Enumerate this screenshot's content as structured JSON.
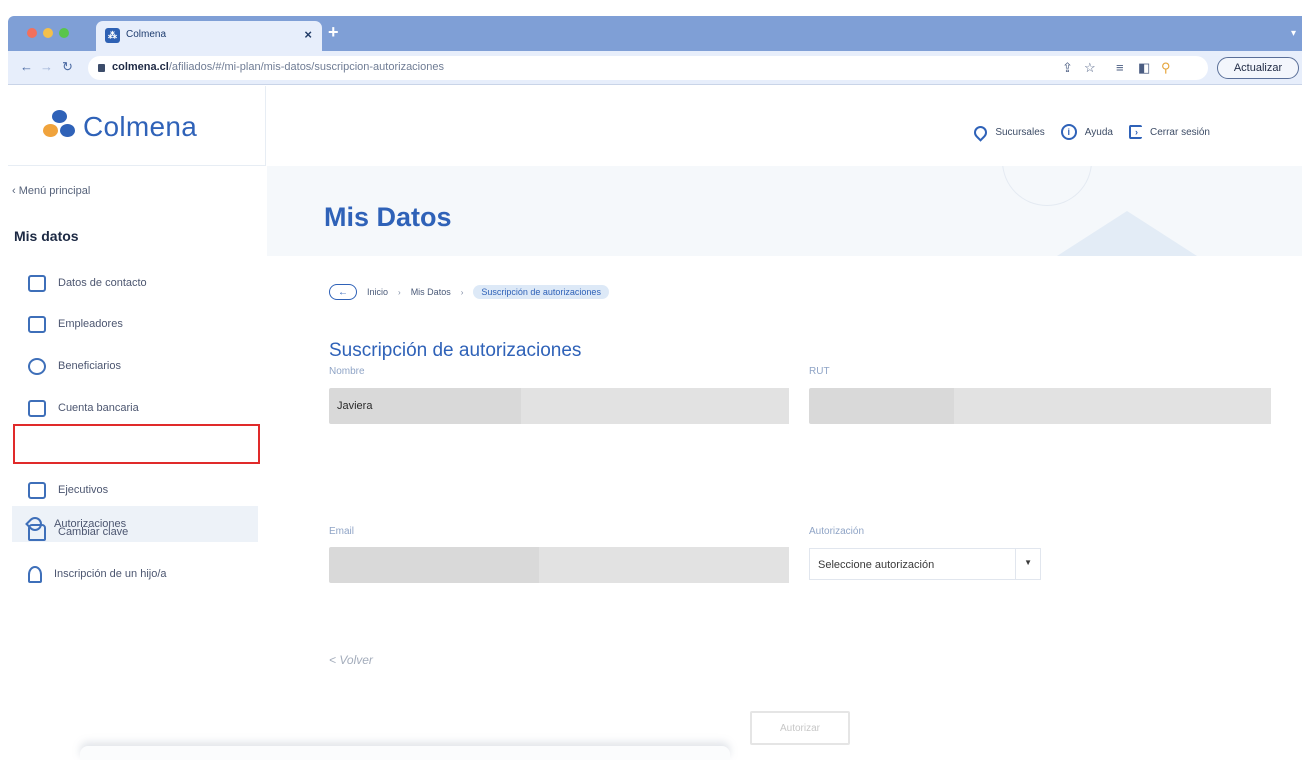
{
  "browser": {
    "tab_title": "Colmena",
    "url_domain": "colmena.cl",
    "url_path": "/afiliados/#/mi-plan/mis-datos/suscripcion-autorizaciones",
    "update_label": "Actualizar"
  },
  "header": {
    "logo_text": "Colmena",
    "links": [
      {
        "label": "Sucursales",
        "icon": "location-pin-icon"
      },
      {
        "label": "Ayuda",
        "icon": "info-icon"
      },
      {
        "label": "Cerrar sesión",
        "icon": "logout-icon"
      }
    ]
  },
  "sidebar": {
    "back_label": "‹ Menú principal",
    "section_title": "Mis datos",
    "items": [
      {
        "label": "Datos de contacto",
        "icon": "contact-card-icon"
      },
      {
        "label": "Empleadores",
        "icon": "building-icon"
      },
      {
        "label": "Beneficiarios",
        "icon": "people-icon"
      },
      {
        "label": "Cuenta bancaria",
        "icon": "bank-account-icon"
      },
      {
        "label": "Autorizaciones",
        "icon": "key-icon",
        "active": true
      },
      {
        "label": "Ejecutivos",
        "icon": "briefcase-icon"
      },
      {
        "label": "Cambiar clave",
        "icon": "lock-icon"
      },
      {
        "label": "Inscripción de un hijo/a",
        "icon": "child-icon"
      }
    ]
  },
  "main": {
    "page_title": "Mis Datos",
    "breadcrumb": [
      "Inicio",
      "Mis Datos",
      "Suscripción de autorizaciones"
    ],
    "form_title": "Suscripción de autorizaciones",
    "fields": {
      "nombre_label": "Nombre",
      "nombre_value": "Javiera",
      "rut_label": "RUT",
      "email_label": "Email",
      "autorizacion_label": "Autorización",
      "autorizacion_selected": "Seleccione autorización"
    },
    "back_link": "< Volver",
    "submit_label": "Autorizar"
  },
  "colors": {
    "brand_blue": "#2f62b8",
    "brand_orange": "#f0a33c",
    "highlight_red": "#e02a2a"
  }
}
